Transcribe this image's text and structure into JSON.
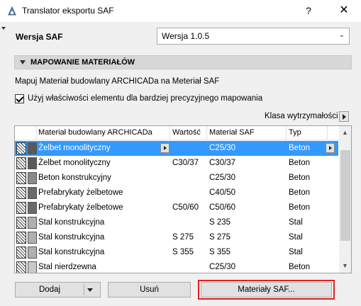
{
  "window": {
    "title": "Translator eksportu SAF",
    "help_label": "?",
    "close_label": "✕",
    "app_icon": "archicad-gear-icon"
  },
  "version": {
    "label": "Wersja SAF",
    "value": "Wersja 1.0.5"
  },
  "section": {
    "title": "MAPOWANIE MATERIAŁÓW",
    "description": "Mapuj Materiał budowlany ARCHICADa na Meteriał SAF",
    "checkbox_label": "Użyj właściwości elementu dla bardziej precyzyjnego mapowania",
    "checkbox_checked": true,
    "strength_class_label": "Klasa wytrzymałości"
  },
  "table": {
    "columns": [
      "Materiał budowlany ARCHICADa",
      "Wartość",
      "Materiał SAF",
      "Typ"
    ],
    "rows": [
      {
        "material": "Żelbet monolityczny",
        "value": "",
        "saf": "C25/30",
        "type": "Beton",
        "swatch": "#5a5a5a",
        "selected": true
      },
      {
        "material": "Żelbet monolityczny",
        "value": "C30/37",
        "saf": "C30/37",
        "type": "Beton",
        "swatch": "#5a5a5a",
        "selected": false
      },
      {
        "material": "Beton konstrukcyjny",
        "value": "",
        "saf": "C25/30",
        "type": "Beton",
        "swatch": "#8a8a8a",
        "selected": false
      },
      {
        "material": "Prefabrykaty żelbetowe",
        "value": "",
        "saf": "C40/50",
        "type": "Beton",
        "swatch": "#6a6a6a",
        "selected": false
      },
      {
        "material": "Prefabrykaty żelbetowe",
        "value": "C50/60",
        "saf": "C50/60",
        "type": "Beton",
        "swatch": "#6a6a6a",
        "selected": false
      },
      {
        "material": "Stal konstrukcyjna",
        "value": "",
        "saf": "S 235",
        "type": "Stal",
        "swatch": "#b0b0b0",
        "selected": false
      },
      {
        "material": "Stal konstrukcyjna",
        "value": "S 275",
        "saf": "S 275",
        "type": "Stal",
        "swatch": "#b0b0b0",
        "selected": false
      },
      {
        "material": "Stal konstrukcyjna",
        "value": "S 355",
        "saf": "S 355",
        "type": "Stal",
        "swatch": "#b0b0b0",
        "selected": false
      },
      {
        "material": "Stal nierdzewna",
        "value": "",
        "saf": "C25/30",
        "type": "Beton",
        "swatch": "#c8c8c8",
        "selected": false
      }
    ]
  },
  "buttons": {
    "add": "Dodaj",
    "remove": "Usuń",
    "saf_materials": "Materiały SAF..."
  },
  "colors": {
    "selection": "#3399ff",
    "highlight_outline": "#e02020"
  }
}
